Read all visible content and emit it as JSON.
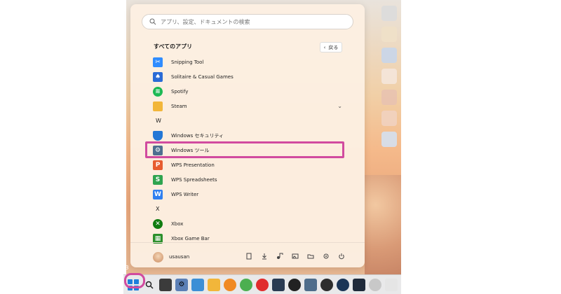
{
  "search": {
    "placeholder": "アプリ、設定、ドキュメントの検索"
  },
  "all_apps": {
    "title": "すべてのアプリ",
    "back_label": "戻る"
  },
  "apps": [
    {
      "label": "Snipping Tool",
      "icon": "snipping-tool-icon",
      "color": "#2f8cff"
    },
    {
      "label": "Solitaire & Casual Games",
      "icon": "solitaire-icon",
      "color": "#2a6bd6"
    },
    {
      "label": "Spotify",
      "icon": "spotify-icon",
      "color": "#1db954"
    },
    {
      "label": "Steam",
      "icon": "folder-icon",
      "color": "#f2b63a"
    },
    {
      "letter": "W"
    },
    {
      "label": "Windows セキュリティ",
      "icon": "shield-icon",
      "color": "#2377d6"
    },
    {
      "label": "Windows ツール",
      "icon": "windows-tools-icon",
      "color": "#4e6f90"
    },
    {
      "label": "WPS Presentation",
      "icon": "wps-presentation-icon",
      "color": "#e75c2f"
    },
    {
      "label": "WPS Spreadsheets",
      "icon": "wps-spreadsheets-icon",
      "color": "#2ea44f"
    },
    {
      "label": "WPS Writer",
      "icon": "wps-writer-icon",
      "color": "#2f7ff0"
    },
    {
      "letter": "X"
    },
    {
      "label": "Xbox",
      "icon": "xbox-icon",
      "color": "#107c10"
    },
    {
      "label": "Xbox Game Bar",
      "icon": "xbox-game-bar-icon",
      "color": "#2b8f2b"
    }
  ],
  "footer": {
    "username": "usausan"
  },
  "start_badge": "3",
  "colors": {
    "highlight": "#d14b9f",
    "accent": "#1e7fdc"
  }
}
